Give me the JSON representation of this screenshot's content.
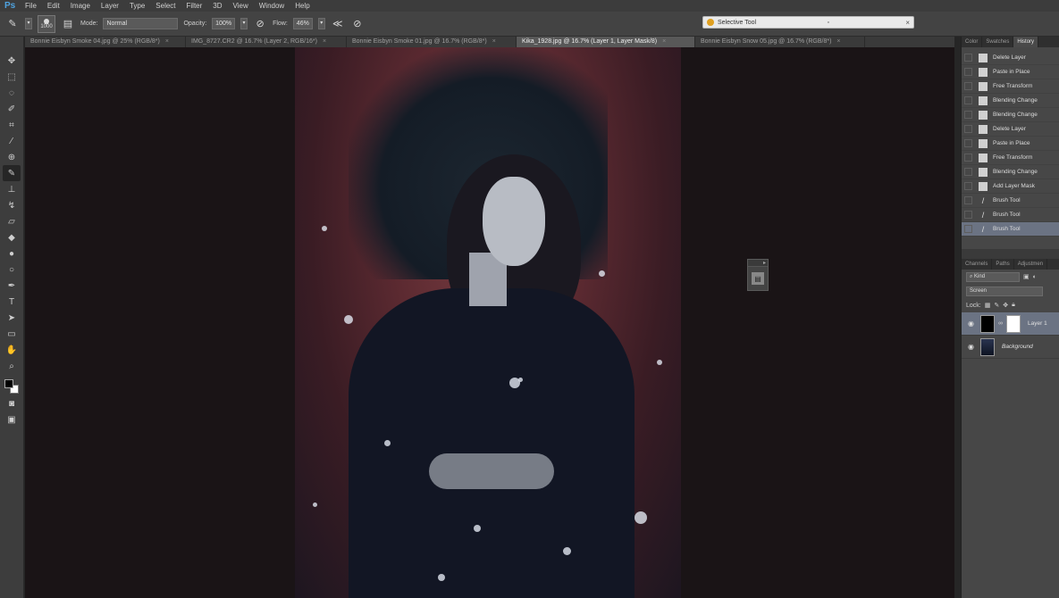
{
  "app": {
    "logo": "Ps"
  },
  "menu": [
    "File",
    "Edit",
    "Image",
    "Layer",
    "Type",
    "Select",
    "Filter",
    "3D",
    "View",
    "Window",
    "Help"
  ],
  "options": {
    "brush_size": "1000",
    "mode_label": "Mode:",
    "mode_value": "Normal",
    "opacity_label": "Opacity:",
    "opacity_value": "100%",
    "flow_label": "Flow:",
    "flow_value": "46%"
  },
  "floating_window": {
    "title": "Selective Tool"
  },
  "tabs": [
    {
      "label": "Bonnie Eisbyn Smoke 04.jpg @ 25% (RGB/8*)",
      "active": false
    },
    {
      "label": "IMG_8727.CR2 @ 16.7% (Layer 2, RGB/16*)",
      "active": false
    },
    {
      "label": "Bonnie Eisbyn Smoke 01.jpg @ 16.7% (RGB/8*)",
      "active": false
    },
    {
      "label": "Kika_1928.jpg @ 16.7% (Layer 1, Layer Mask/8)",
      "active": true
    },
    {
      "label": "Bonnie Eisbyn Snow 05.jpg @ 16.7% (RGB/8*)",
      "active": false
    }
  ],
  "tab_close_glyph": "×",
  "panels": {
    "top_tabs": [
      "Color",
      "Swatches",
      "History"
    ],
    "history": [
      {
        "label": "Delete Layer",
        "icon": "doc-icon"
      },
      {
        "label": "Paste in Place",
        "icon": "doc-icon"
      },
      {
        "label": "Free Transform",
        "icon": "doc-icon"
      },
      {
        "label": "Blending Change",
        "icon": "doc-icon"
      },
      {
        "label": "Blending Change",
        "icon": "doc-icon"
      },
      {
        "label": "Delete Layer",
        "icon": "doc-icon"
      },
      {
        "label": "Paste in Place",
        "icon": "doc-icon"
      },
      {
        "label": "Free Transform",
        "icon": "doc-icon"
      },
      {
        "label": "Blending Change",
        "icon": "doc-icon"
      },
      {
        "label": "Add Layer Mask",
        "icon": "doc-icon"
      },
      {
        "label": "Brush Tool",
        "icon": "brush-icon"
      },
      {
        "label": "Brush Tool",
        "icon": "brush-icon"
      },
      {
        "label": "Brush Tool",
        "icon": "brush-icon"
      }
    ],
    "layers_tabs": [
      "Channels",
      "Paths",
      "Adjustmen"
    ],
    "filter_kind": "Kind",
    "blend_mode": "Screen",
    "lock_label": "Lock:",
    "layers": [
      {
        "name": "Layer 1",
        "active": true
      },
      {
        "name": "Background",
        "active": false
      }
    ]
  },
  "colors": {
    "accent": "#6b7383",
    "bg": "#262626"
  }
}
